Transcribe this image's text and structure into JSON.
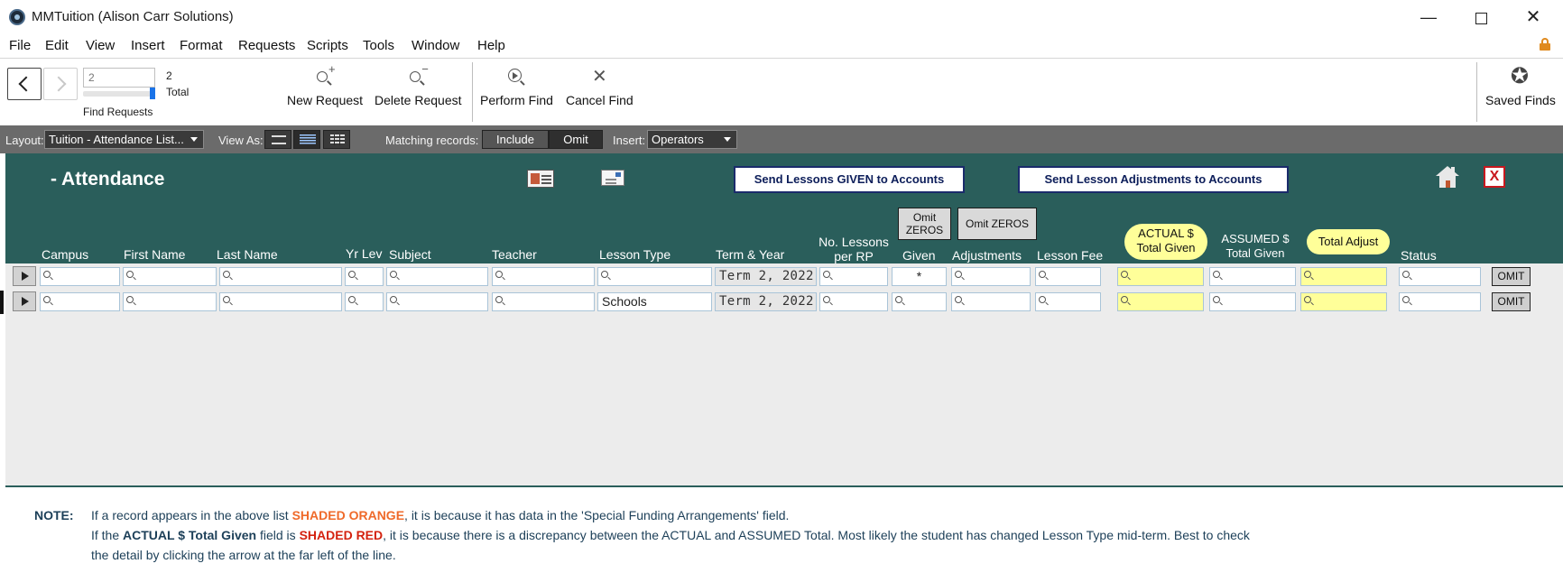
{
  "window": {
    "title": "MMTuition (Alison Carr Solutions)",
    "minimize": "—",
    "close": "✕"
  },
  "menu": [
    "File",
    "Edit",
    "View",
    "Insert",
    "Format",
    "Requests",
    "Scripts",
    "Tools",
    "Window",
    "Help"
  ],
  "toolbar": {
    "record_value": "2",
    "record_count": "2",
    "total_label": "Total",
    "find_requests_label": "Find Requests",
    "new_request": "New Request",
    "delete_request": "Delete Request",
    "perform_find": "Perform Find",
    "cancel_find": "Cancel Find",
    "saved_finds": "Saved Finds",
    "slider_fraction": 1.0
  },
  "layout_bar": {
    "layout_label": "Layout:",
    "layout_value": "Tuition - Attendance List...",
    "view_as_label": "View As:",
    "matching_label": "Matching records:",
    "include": "Include",
    "omit": "Omit",
    "insert_label": "Insert:",
    "insert_value": "Operators"
  },
  "header": {
    "title": "- Attendance",
    "send_given": "Send Lessons GIVEN to Accounts",
    "send_adjustments": "Send Lesson Adjustments to Accounts",
    "close_glyph": "X",
    "omit_zeros_given": "Omit ZEROS",
    "omit_zeros_adj": "Omit ZEROS"
  },
  "columns": {
    "campus": "Campus",
    "first_name": "First Name",
    "last_name": "Last Name",
    "yr_lev": "Yr Lev",
    "subject": "Subject",
    "teacher": "Teacher",
    "lesson_type": "Lesson Type",
    "term_year": "Term & Year",
    "no_lessons_1": "No. Lessons",
    "no_lessons_2": "per RP",
    "given": "Given",
    "adjustments": "Adjustments",
    "lesson_fee": "Lesson Fee",
    "actual_1": "ACTUAL $",
    "actual_2": "Total Given",
    "assumed_1": "ASSUMED $",
    "assumed_2": "Total Given",
    "total_adjust": "Total Adjust",
    "status": "Status"
  },
  "rows": [
    {
      "lesson_type": "",
      "term_year": "Term 2, 2022",
      "given": "*",
      "omit": "OMIT"
    },
    {
      "lesson_type": "Schools",
      "term_year": "Term 2, 2022",
      "given": "",
      "omit": "OMIT"
    }
  ],
  "notes": {
    "label": "NOTE:",
    "line1_a": "If a record appears in the above list ",
    "line1_b": "SHADED ORANGE",
    "line1_c": ", it is because it has data in the 'Special Funding Arrangements' field.",
    "line2_a": "If the ",
    "line2_b": "ACTUAL $ Total Given",
    "line2_c": " field is ",
    "line2_d": "SHADED RED",
    "line2_e": ", it is because there is a discrepancy between the ACTUAL and ASSUMED Total.  Most likely the student has changed Lesson Type mid-term.  Best to check",
    "line3": "the detail by clicking the arrow at the far left of the line."
  },
  "colors": {
    "header_teal": "#2a5e5b",
    "highlight_yellow": "#ffff99",
    "note_orange": "#ef6a2a",
    "note_red": "#d4220f",
    "button_navy": "#1a2b6b"
  }
}
